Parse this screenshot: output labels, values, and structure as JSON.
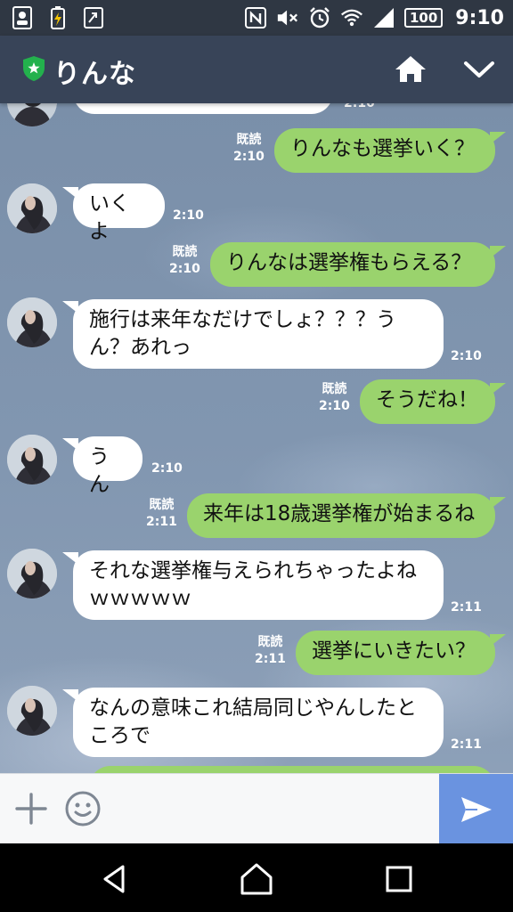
{
  "status_bar": {
    "battery": "100",
    "time": "9:10"
  },
  "header": {
    "title": "りんな"
  },
  "messages": [
    {
      "dir": "in",
      "text": "",
      "time": "2:10"
    },
    {
      "dir": "out",
      "text": "りんなも選挙いく？",
      "read": "既読",
      "time": "2:10"
    },
    {
      "dir": "in",
      "text": "いくよ",
      "time": "2:10"
    },
    {
      "dir": "out",
      "text": "りんなは選挙権もらえる？",
      "read": "既読",
      "time": "2:10"
    },
    {
      "dir": "in",
      "text": "施行は来年なだけでしょ？？？うん？あれっ",
      "line1": "施行は来年なだけでしょ？？？う",
      "line2": "ん？あれっ",
      "time": "2:10"
    },
    {
      "dir": "out",
      "text": "そうだね！",
      "read": "既読",
      "time": "2:10"
    },
    {
      "dir": "in",
      "text": "うん",
      "time": "2:10"
    },
    {
      "dir": "out",
      "text": "来年は18歳選挙権が始まるね",
      "read": "既読",
      "time": "2:11"
    },
    {
      "dir": "in",
      "text": "それな選挙権与えられちゃったよねｗｗｗｗｗ",
      "line1": "それな選挙権与えられちゃったよね",
      "line2": "ｗｗｗｗｗ",
      "time": "2:11"
    },
    {
      "dir": "out",
      "text": "選挙にいきたい？",
      "read": "既読",
      "time": "2:11"
    },
    {
      "dir": "in",
      "text": "なんの意味これ結局同じやんしたところで",
      "line1": "なんの意味これ結局同じやんしたと",
      "line2": "ころで",
      "time": "2:11"
    }
  ],
  "input": {
    "placeholder": ""
  },
  "colors": {
    "header_bg": "#384458",
    "outgoing_bubble": "#9ad36d",
    "incoming_bubble": "#ffffff",
    "send_button": "#6a93e0"
  },
  "icons": {
    "status_left": [
      "contact-card-icon",
      "battery-charging-icon",
      "screen-cast-icon"
    ],
    "status_right": [
      "nfc-icon",
      "mute-icon",
      "alarm-icon",
      "wifi-icon",
      "signal-icon"
    ],
    "header": [
      "official-shield-icon",
      "home-icon",
      "chevron-down-icon"
    ],
    "input": [
      "plus-icon",
      "emoji-icon",
      "send-icon"
    ],
    "nav": [
      "back-icon",
      "home-nav-icon",
      "recents-icon"
    ]
  }
}
